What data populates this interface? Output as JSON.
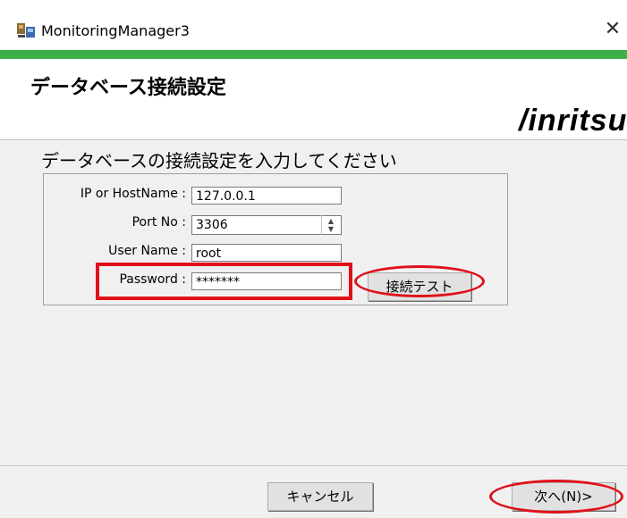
{
  "window": {
    "title": "MonitoringManager3",
    "close_glyph": "✕",
    "app_icon": "monitoring-app-icon"
  },
  "header": {
    "title": "データベース接続設定",
    "brand": "/inritsu"
  },
  "main": {
    "instruction": "データベースの接続設定を入力してください",
    "fields": {
      "ip": {
        "label": "IP or HostName :",
        "value": "127.0.0.1"
      },
      "port": {
        "label": "Port No :",
        "value": "3306"
      },
      "user": {
        "label": "User Name :",
        "value": "root"
      },
      "password": {
        "label": "Password :",
        "value": "*******"
      }
    },
    "test_button": "接続テスト"
  },
  "footer": {
    "cancel_button": "キャンセル",
    "next_button": "次へ(N)>"
  },
  "colors": {
    "accent": "#3cb046",
    "annotation": "#e0101a",
    "dialog_bg": "#f0f0f0"
  }
}
